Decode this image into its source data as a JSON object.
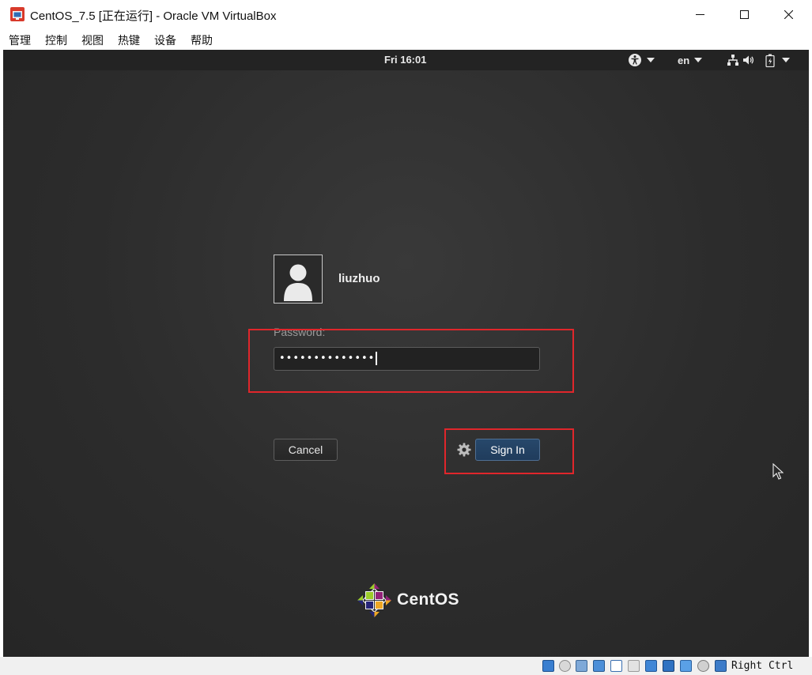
{
  "window": {
    "title": "CentOS_7.5 [正在运行] - Oracle VM VirtualBox",
    "app_icon": "virtualbox-icon",
    "controls": [
      "minimize-icon",
      "maximize-icon",
      "close-icon"
    ]
  },
  "menubar": {
    "items": [
      "管理",
      "控制",
      "视图",
      "热键",
      "设备",
      "帮助"
    ]
  },
  "guest": {
    "topbar": {
      "clock": "Fri 16:01",
      "accessibility_icon": "accessibility-icon",
      "language": "en",
      "status_icons": [
        "network-wired-icon",
        "volume-icon",
        "battery-icon"
      ]
    },
    "login": {
      "avatar_icon": "user-avatar-icon",
      "username": "liuzhuo",
      "password_label": "Password:",
      "password_value": "••••••••••••••",
      "cancel_label": "Cancel",
      "sign_in_label": "Sign In",
      "session_icon": "gear-icon"
    },
    "brand": {
      "logo_icon": "centos-logo-icon",
      "name": "CentOS"
    }
  },
  "statusbar": {
    "icons": [
      "hard-disk-icon",
      "optical-drive-icon",
      "audio-icon",
      "network-icon",
      "usb-icon",
      "shared-folders-icon",
      "display-icon",
      "recording-icon",
      "cpu-icon",
      "mouse-integration-icon",
      "keyboard-capture-icon"
    ],
    "host_key": "Right Ctrl"
  },
  "colors": {
    "highlight": "#e0262b",
    "sign_in_button": "#244566",
    "guest_background": "#2e2e2e",
    "guest_topbar": "#232323"
  }
}
